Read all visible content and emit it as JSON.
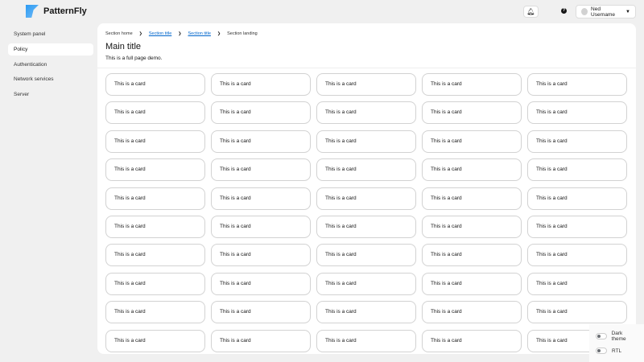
{
  "brand": {
    "name": "PatternFly"
  },
  "header": {
    "user_name": "Ned Username",
    "icons": [
      "bell-icon",
      "help-icon",
      "caret-down-icon"
    ]
  },
  "sidebar": {
    "items": [
      {
        "label": "System panel"
      },
      {
        "label": "Policy",
        "active": true
      },
      {
        "label": "Authentication"
      },
      {
        "label": "Network services"
      },
      {
        "label": "Server"
      }
    ]
  },
  "breadcrumb": {
    "items": [
      "Section home",
      "Section title",
      "Section title",
      "Section landing"
    ]
  },
  "page": {
    "title": "Main title",
    "subtitle": "This is a full page demo."
  },
  "cards": {
    "label": "This is a card",
    "count": 50
  },
  "toggles": {
    "dark_theme": "Dark theme",
    "rtl": "RTL"
  }
}
